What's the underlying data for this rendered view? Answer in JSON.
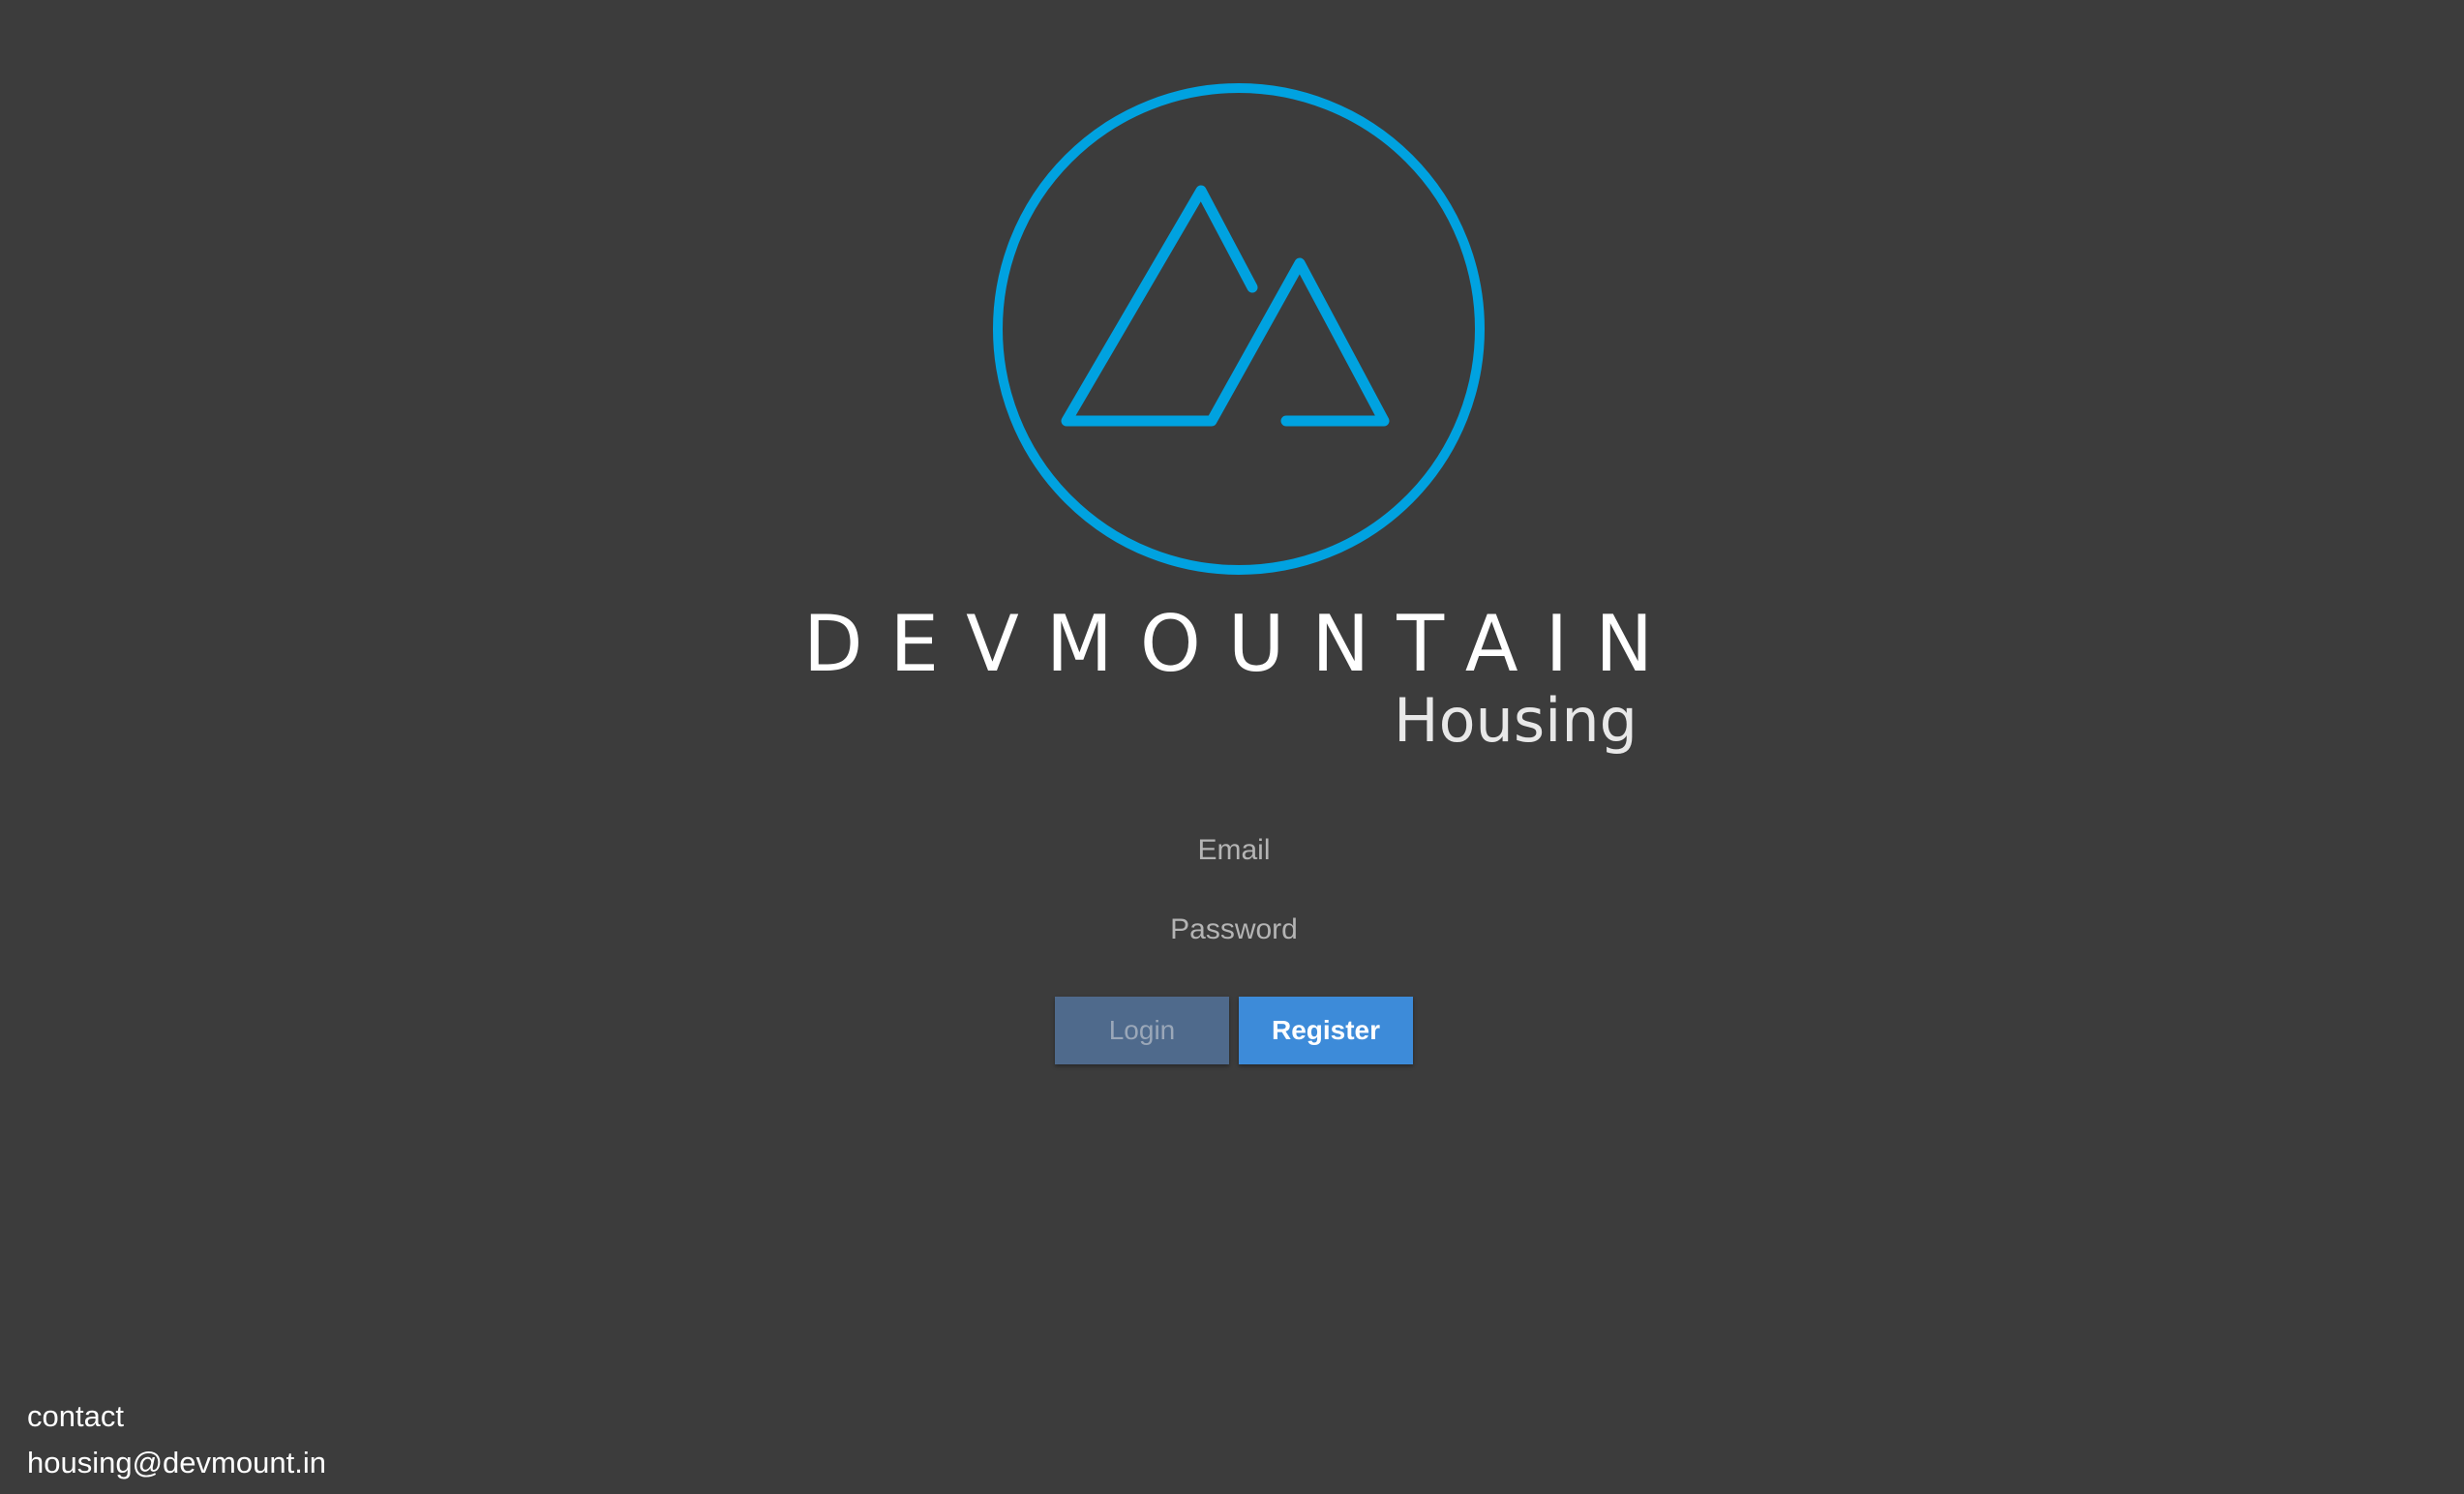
{
  "brand": {
    "name": "DEVMOUNTAIN",
    "subtitle": "Housing",
    "logo_icon": "mountain-circle-logo",
    "accent_color": "#00a2e0"
  },
  "form": {
    "email_placeholder": "Email",
    "password_placeholder": "Password",
    "login_label": "Login",
    "register_label": "Register"
  },
  "footer": {
    "contact_label": "contact",
    "email": "housing@devmount.in"
  },
  "colors": {
    "background": "#3c3c3c",
    "login_button": "#4f6a8c",
    "register_button": "#3d8bd9"
  }
}
